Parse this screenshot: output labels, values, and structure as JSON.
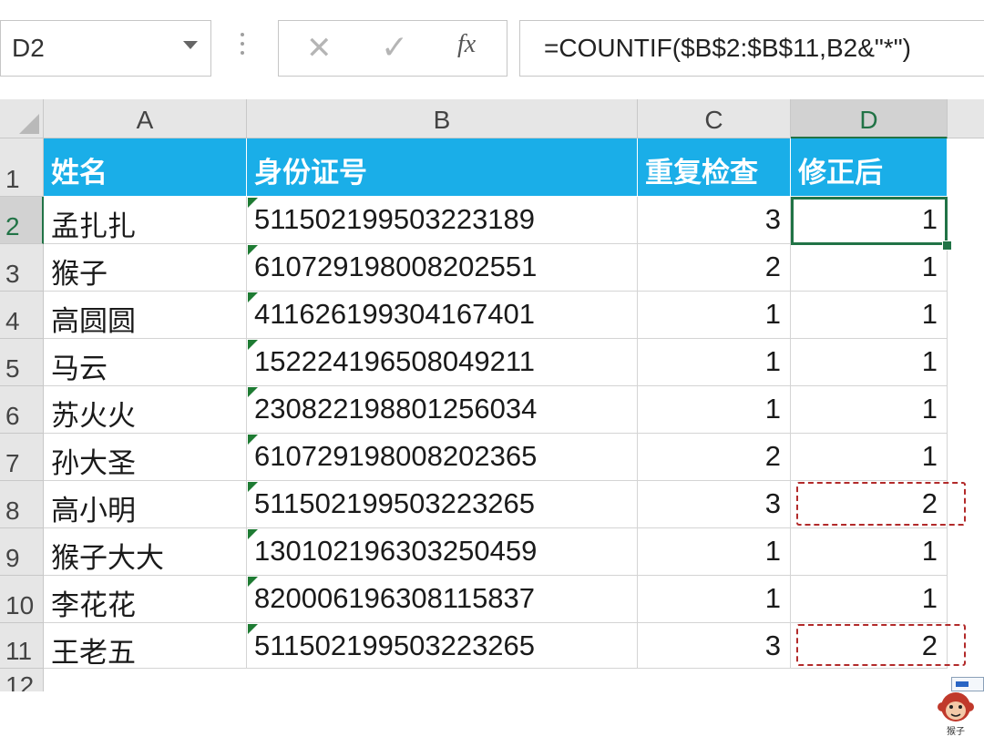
{
  "formula_bar": {
    "name_box": "D2",
    "cancel_icon": "✕",
    "enter_icon": "✓",
    "fx_label": "fx",
    "formula": "=COUNTIF($B$2:$B$11,B2&\"*\")"
  },
  "sheet": {
    "columns": [
      "A",
      "B",
      "C",
      "D"
    ],
    "row_numbers": [
      "1",
      "2",
      "3",
      "4",
      "5",
      "6",
      "7",
      "8",
      "9",
      "10",
      "11"
    ],
    "partial_row_number": "12",
    "header_row": [
      "姓名",
      "身份证号",
      "重复检查",
      "修正后"
    ],
    "rows": [
      [
        "孟扎扎",
        "511502199503223189",
        "3",
        "1"
      ],
      [
        "猴子",
        "610729198008202551",
        "2",
        "1"
      ],
      [
        "高圆圆",
        "411626199304167401",
        "1",
        "1"
      ],
      [
        "马云",
        "152224196508049211",
        "1",
        "1"
      ],
      [
        "苏火火",
        "230822198801256034",
        "1",
        "1"
      ],
      [
        "孙大圣",
        "610729198008202365",
        "2",
        "1"
      ],
      [
        "高小明",
        "511502199503223265",
        "3",
        "2"
      ],
      [
        "猴子大大",
        "130102196303250459",
        "1",
        "1"
      ],
      [
        "李花花",
        "820006196308115837",
        "1",
        "1"
      ],
      [
        "王老五",
        "511502199503223265",
        "3",
        "2"
      ]
    ],
    "active_cell": "D2",
    "highlighted_cells": [
      "D8",
      "D11"
    ]
  },
  "watermark": {
    "icon": "monkey-face-icon",
    "text": "猴子"
  },
  "colors": {
    "header_fill": "#1aaee8",
    "header_text": "#ffffff",
    "selection": "#217346",
    "highlight_dash": "#b22a2a",
    "text_marker": "#1e7b33"
  }
}
